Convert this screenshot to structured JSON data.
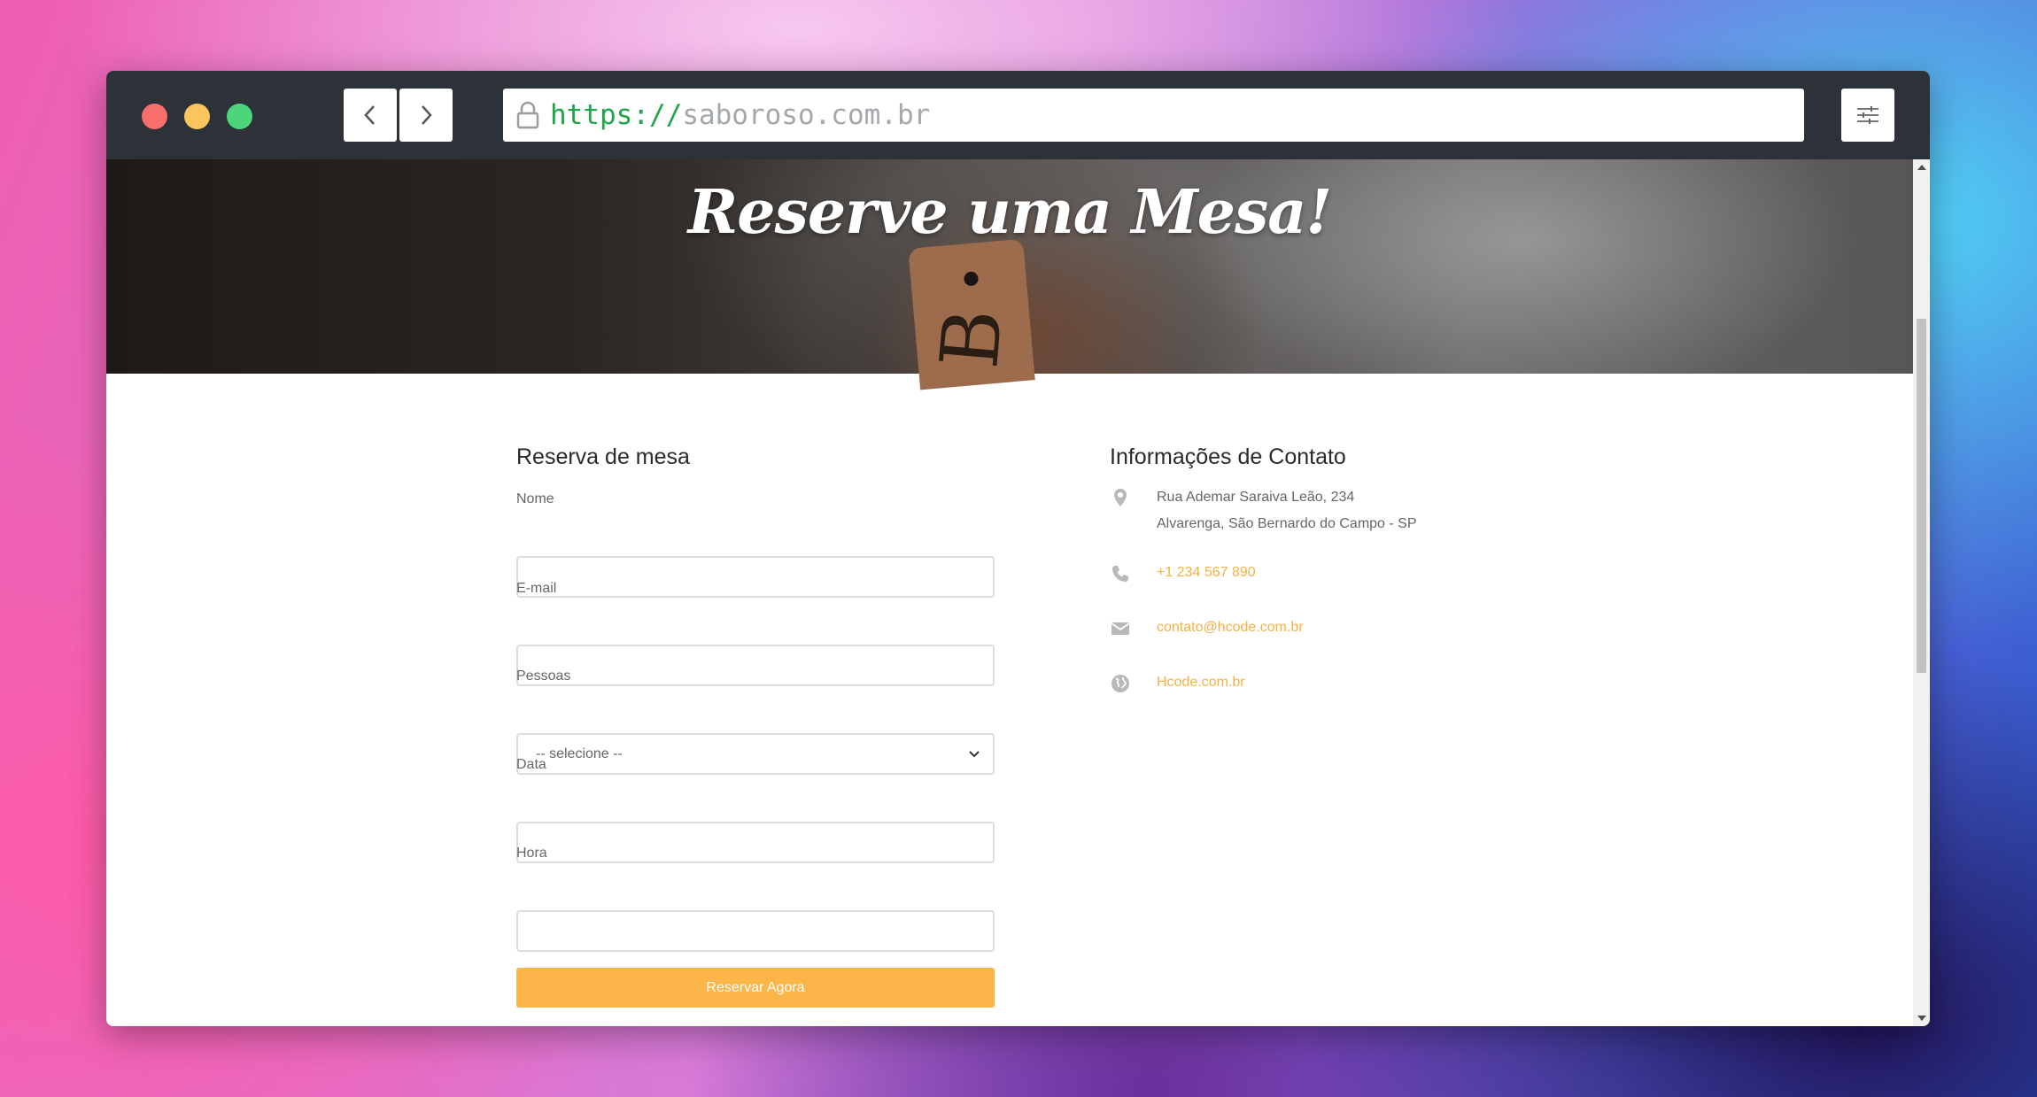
{
  "browser": {
    "url_scheme": "https://",
    "url_host": "saboroso.com.br"
  },
  "hero": {
    "title": "Reserve uma Mesa!"
  },
  "reservation": {
    "title": "Reserva de mesa",
    "fields": {
      "name_label": "Nome",
      "email_label": "E-mail",
      "people_label": "Pessoas",
      "people_selected": "-- selecione --",
      "date_label": "Data",
      "time_label": "Hora"
    },
    "submit_label": "Reservar Agora"
  },
  "contact": {
    "title": "Informações de Contato",
    "address_line1": "Rua Ademar Saraiva Leão, 234",
    "address_line2": "Alvarenga, São Bernardo do Campo - SP",
    "phone": "+1 234 567 890",
    "email": "contato@hcode.com.br",
    "website": "Hcode.com.br"
  },
  "colors": {
    "accent": "#fbb548",
    "link": "#f5b042",
    "titlebar": "#2c3237",
    "url_scheme": "#1fa64a"
  },
  "icons": [
    "lock-icon",
    "chevron-left-icon",
    "chevron-right-icon",
    "sliders-icon",
    "map-pin-icon",
    "phone-icon",
    "envelope-icon",
    "globe-icon",
    "arrow-up-icon"
  ]
}
